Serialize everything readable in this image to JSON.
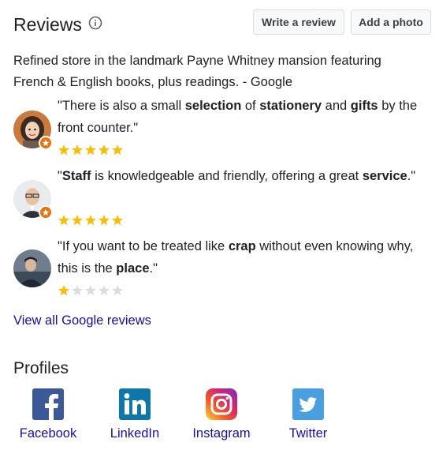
{
  "header": {
    "title": "Reviews",
    "write_review_label": "Write a review",
    "add_photo_label": "Add a photo",
    "info_icon": "info-circle-icon"
  },
  "description": "Refined store in the landmark Payne Whitney mansion featuring French & English books, plus readings. - Google",
  "reviews": [
    {
      "parts": [
        "\"There is also a small ",
        "selection",
        " of ",
        "stationery",
        " and ",
        "gifts",
        " by the front counter.\""
      ],
      "rating": 5,
      "avatar": "user-avatar-woman"
    },
    {
      "parts": [
        "\"",
        "Staff",
        " is knowledgeable and friendly, offering a great ",
        "service",
        ".\""
      ],
      "rating": 5,
      "avatar": "user-avatar-man-glasses"
    },
    {
      "parts": [
        "\"If you want to be treated like ",
        "crap",
        " without even knowing why, this is the ",
        "place",
        ".\""
      ],
      "rating": 1,
      "avatar": "user-avatar-man"
    }
  ],
  "view_all_label": "View all Google reviews",
  "profiles": {
    "title": "Profiles",
    "items": [
      {
        "label": "Facebook",
        "icon": "facebook-icon",
        "color": "#3b5998"
      },
      {
        "label": "LinkedIn",
        "icon": "linkedin-icon",
        "color": "#0e76a8"
      },
      {
        "label": "Instagram",
        "icon": "instagram-icon",
        "color": "#c13584"
      },
      {
        "label": "Twitter",
        "icon": "twitter-icon",
        "color": "#4a9fe0"
      }
    ]
  },
  "colors": {
    "star_filled": "#fbbc04",
    "star_empty": "#dadce0",
    "link": "#1a0dab",
    "badge": "#e8710a"
  }
}
